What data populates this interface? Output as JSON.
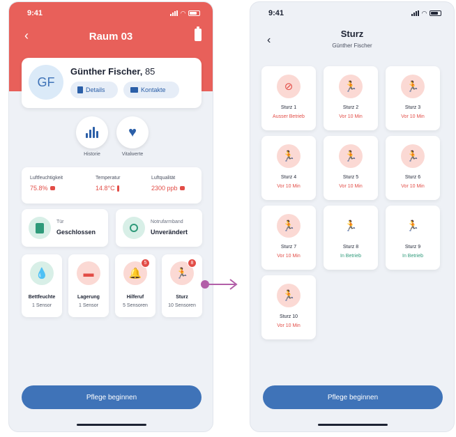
{
  "colors": {
    "header_red": "#e8605a",
    "primary_blue": "#3f73b8",
    "alert_red": "#e24d47",
    "ok_green": "#2f9a7a",
    "connector_purple": "#b25fa8"
  },
  "left": {
    "status_time": "9:41",
    "header_title": "Raum 03",
    "patient": {
      "initials": "GF",
      "name": "Günther Fischer,",
      "age": "85"
    },
    "buttons": {
      "details": "Details",
      "kontakte": "Kontakte"
    },
    "quick": [
      {
        "label": "Historie",
        "icon": "bar-chart-icon"
      },
      {
        "label": "Vitalwerte",
        "icon": "heart-pulse-icon"
      }
    ],
    "environment": [
      {
        "label": "Luftfeuchtigkeit",
        "value": "75.8%",
        "icon": "drop-icon"
      },
      {
        "label": "Temperatur",
        "value": "14.8°C",
        "icon": "thermometer-icon"
      },
      {
        "label": "Luftqualität",
        "value": "2300 ppb",
        "icon": "cloud-icon"
      }
    ],
    "status_cards": [
      {
        "label": "Tür",
        "value": "Geschlossen",
        "icon": "door-icon"
      },
      {
        "label": "Notrufarmband",
        "value": "Unverändert",
        "icon": "watch-icon"
      }
    ],
    "sensors": [
      {
        "name": "Bettfeuchte",
        "sub": "1 Sensor",
        "icon": "droplets-icon"
      },
      {
        "name": "Lagerung",
        "sub": "1 Sensor",
        "icon": "bed-icon"
      },
      {
        "name": "Hilferuf",
        "sub": "5 Sensoren",
        "icon": "bell-icon",
        "badge": "5"
      },
      {
        "name": "Sturz",
        "sub": "10 Sensoren",
        "icon": "fall-icon",
        "badge": "8"
      }
    ],
    "cta": "Pflege beginnen"
  },
  "right": {
    "status_time": "9:41",
    "title": "Sturz",
    "subtitle": "Günther Fischer",
    "tiles": [
      {
        "name": "Sturz 1",
        "status": "Ausser Betrieb",
        "state": "offline",
        "icon": "signal-off-icon"
      },
      {
        "name": "Sturz 2",
        "status": "Vor 10 Min",
        "state": "alert",
        "icon": "fall-icon"
      },
      {
        "name": "Sturz 3",
        "status": "Vor 10 Min",
        "state": "alert",
        "icon": "fall-icon"
      },
      {
        "name": "Sturz 4",
        "status": "Vor 10 Min",
        "state": "alert",
        "icon": "fall-icon"
      },
      {
        "name": "Sturz 5",
        "status": "Vor 10 Min",
        "state": "alert",
        "icon": "fall-icon"
      },
      {
        "name": "Sturz 6",
        "status": "Vor 10 Min",
        "state": "alert",
        "icon": "fall-icon"
      },
      {
        "name": "Sturz 7",
        "status": "Vor 10 Min",
        "state": "alert",
        "icon": "fall-icon"
      },
      {
        "name": "Sturz 8",
        "status": "In Betrieb",
        "state": "ok",
        "icon": "fall-icon"
      },
      {
        "name": "Sturz 9",
        "status": "In Betrieb",
        "state": "ok",
        "icon": "fall-icon"
      },
      {
        "name": "Sturz 10",
        "status": "Vor 10 Min",
        "state": "alert",
        "icon": "fall-icon"
      }
    ],
    "cta": "Pflege beginnen"
  }
}
